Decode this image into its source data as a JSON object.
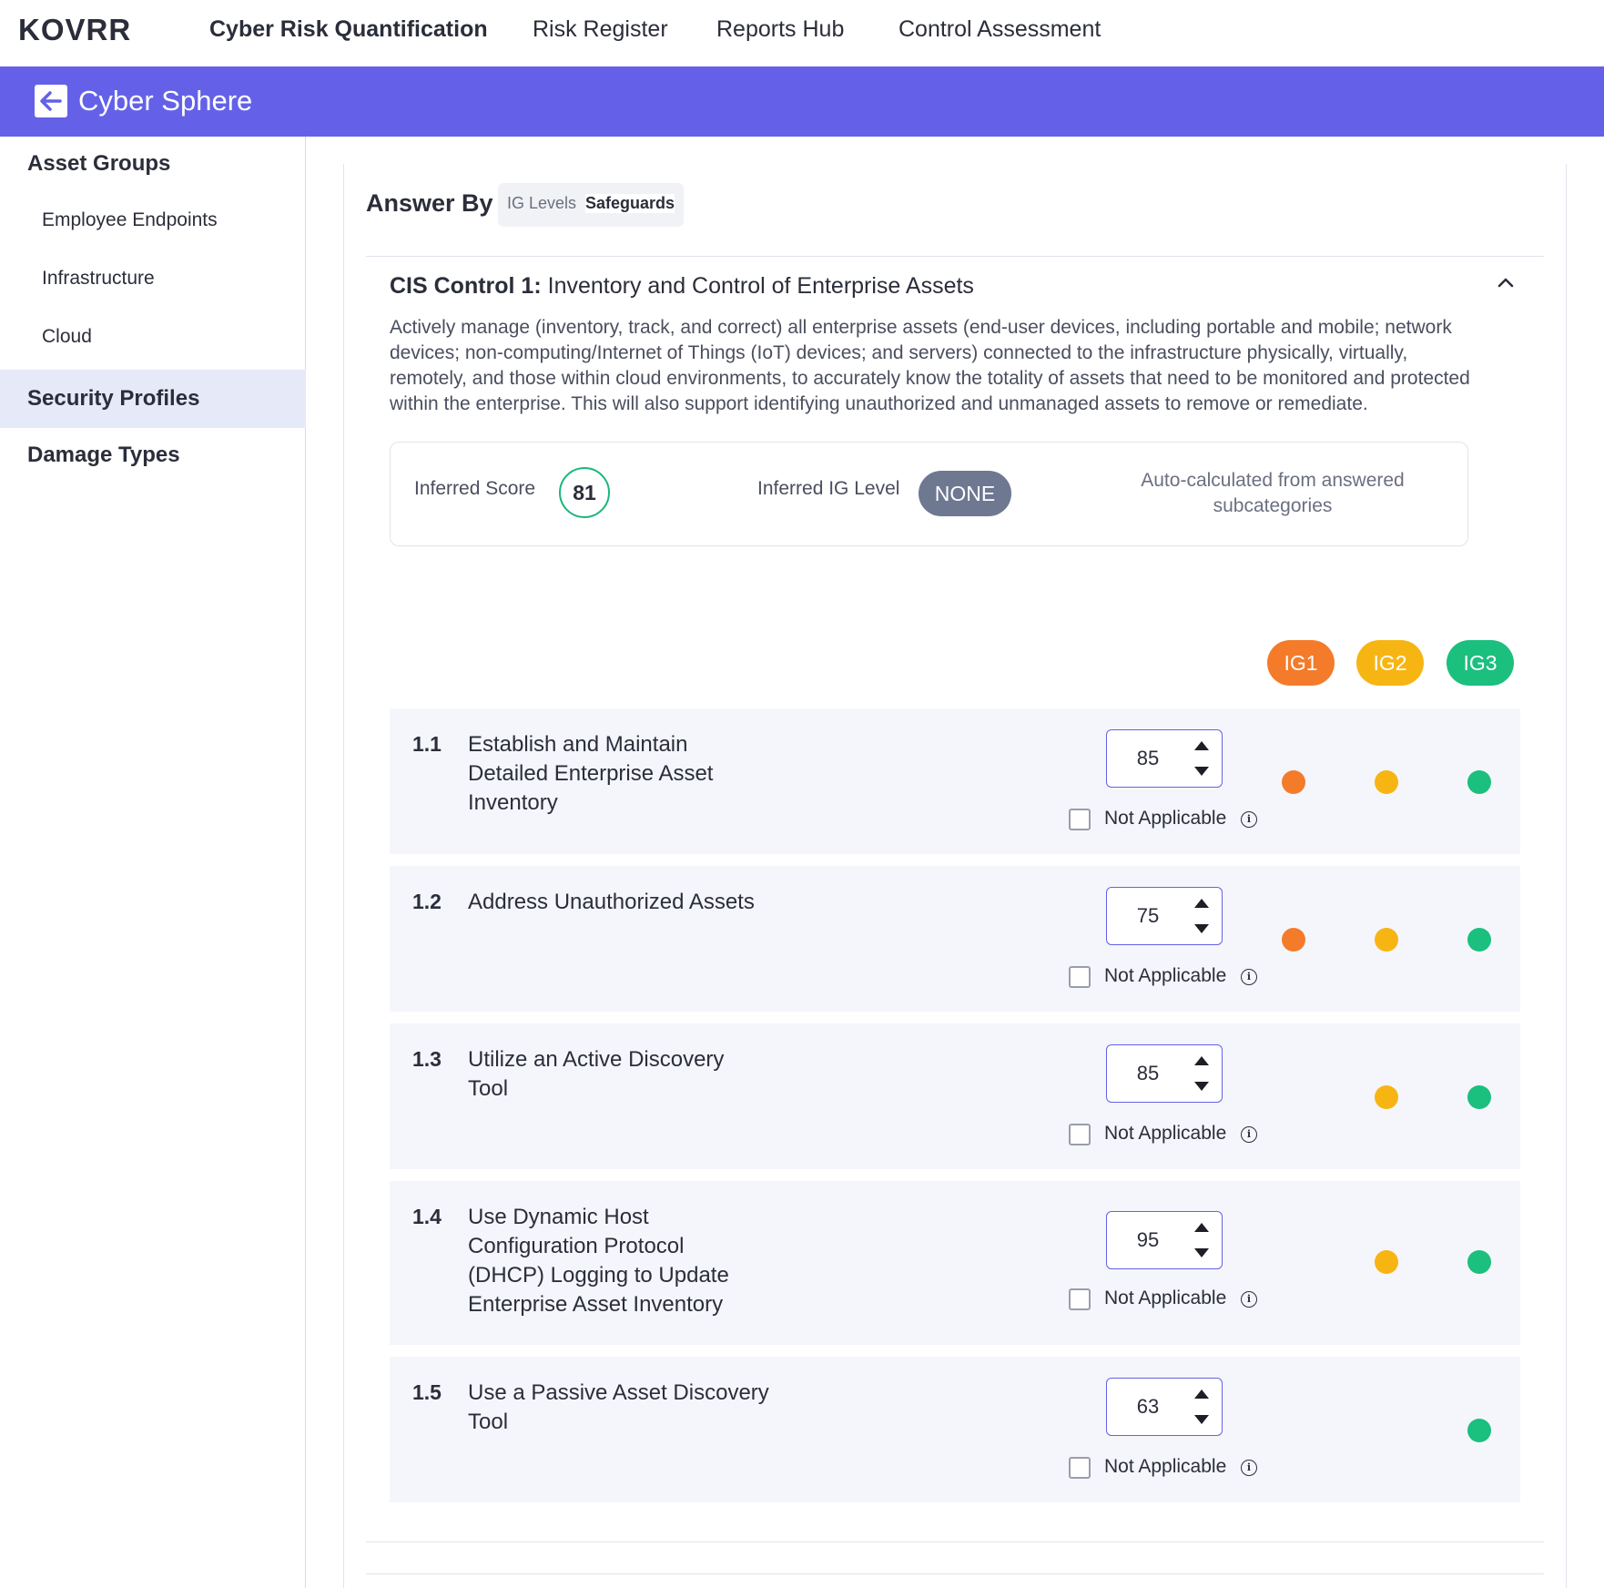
{
  "nav": {
    "logo": "KOVRR",
    "links": [
      "Cyber Risk Quantification",
      "Risk Register",
      "Reports Hub",
      "Control Assessment"
    ]
  },
  "banner": {
    "title": "Cyber Sphere"
  },
  "sidebar": {
    "asset_groups": "Asset Groups",
    "sub_items": [
      "Employee Endpoints",
      "Infrastructure",
      "Cloud"
    ],
    "security_profiles": "Security Profiles",
    "damage_types": "Damage Types"
  },
  "answer_by": {
    "label": "Answer By",
    "options": [
      "IG Levels",
      "Safeguards"
    ],
    "selected": "Safeguards"
  },
  "control": {
    "prefix": "CIS Control 1:",
    "name": "Inventory and Control of Enterprise Assets",
    "description": "Actively manage (inventory, track, and correct) all enterprise assets (end-user devices, including portable and mobile; network devices; non-computing/Internet of Things (IoT) devices; and servers) connected to the infrastructure physically, virtually, remotely, and those within cloud environments, to accurately know the totality of assets that need to be monitored and protected within the enterprise. This will also support identifying unauthorized and unmanaged assets to remove or remediate."
  },
  "summary": {
    "inferred_score_label": "Inferred Score",
    "inferred_score": "81",
    "inferred_ig_label": "Inferred IG Level",
    "inferred_ig": "NONE",
    "note": "Auto-calculated from answered subcategories"
  },
  "ig_levels": [
    {
      "label": "IG1",
      "color": "#f47b2a"
    },
    {
      "label": "IG2",
      "color": "#f7b514"
    },
    {
      "label": "IG3",
      "color": "#1bbf7e"
    }
  ],
  "na_label": "Not Applicable",
  "safeguards": [
    {
      "num": "1.1",
      "title": "Establish and Maintain Detailed Enterprise Asset Inventory",
      "value": "85",
      "ig": [
        true,
        true,
        true
      ]
    },
    {
      "num": "1.2",
      "title": "Address Unauthorized Assets",
      "value": "75",
      "ig": [
        true,
        true,
        true
      ]
    },
    {
      "num": "1.3",
      "title": "Utilize an Active Discovery Tool",
      "value": "85",
      "ig": [
        false,
        true,
        true
      ]
    },
    {
      "num": "1.4",
      "title": "Use Dynamic Host Configuration Protocol (DHCP) Logging to Update Enterprise Asset Inventory",
      "value": "95",
      "ig": [
        false,
        true,
        true
      ]
    },
    {
      "num": "1.5",
      "title": "Use a Passive Asset Discovery Tool",
      "value": "63",
      "ig": [
        false,
        false,
        true
      ]
    }
  ]
}
